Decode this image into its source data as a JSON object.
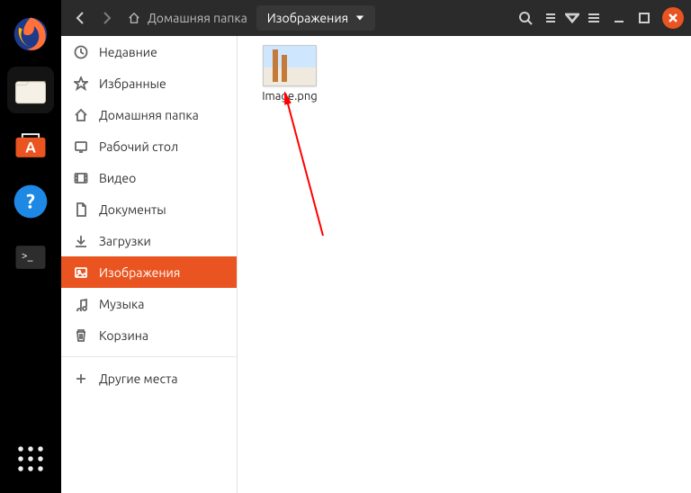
{
  "breadcrumb": {
    "home_label": "Домашняя папка",
    "current": "Изображения"
  },
  "sidebar": {
    "items": [
      {
        "id": "recent",
        "label": "Недавние",
        "icon": "clock-icon"
      },
      {
        "id": "starred",
        "label": "Избранные",
        "icon": "star-icon"
      },
      {
        "id": "home",
        "label": "Домашняя папка",
        "icon": "home-icon"
      },
      {
        "id": "desktop",
        "label": "Рабочий стол",
        "icon": "desktop-icon"
      },
      {
        "id": "videos",
        "label": "Видео",
        "icon": "video-icon"
      },
      {
        "id": "documents",
        "label": "Документы",
        "icon": "document-icon"
      },
      {
        "id": "downloads",
        "label": "Загрузки",
        "icon": "download-icon"
      },
      {
        "id": "pictures",
        "label": "Изображения",
        "icon": "image-icon",
        "active": true
      },
      {
        "id": "music",
        "label": "Музыка",
        "icon": "music-icon"
      },
      {
        "id": "trash",
        "label": "Корзина",
        "icon": "trash-icon"
      }
    ],
    "other_places_label": "Другие места"
  },
  "files": [
    {
      "name": "Image.png"
    }
  ],
  "colors": {
    "accent": "#e95420",
    "header_bg": "#2b2b2b",
    "dock_bg": "#000000"
  }
}
